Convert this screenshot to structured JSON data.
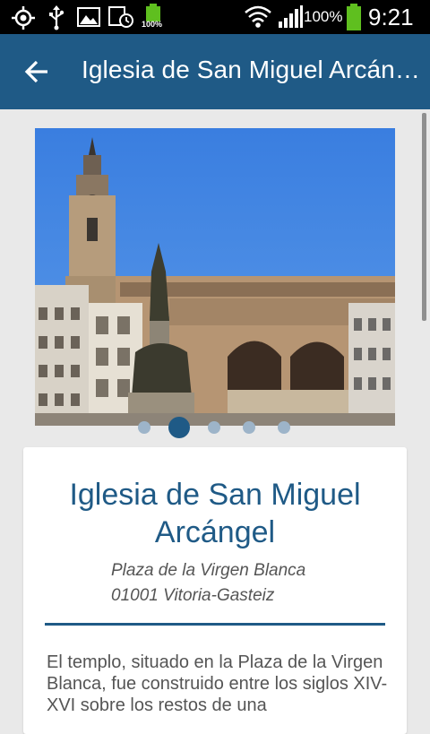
{
  "status_bar": {
    "battery_percent": "100%",
    "time": "9:21",
    "mini_battery_label": "100%",
    "icons": [
      "gps-icon",
      "usb-icon",
      "gallery-icon",
      "screenshot-icon",
      "battery-status-icon",
      "wifi-icon",
      "signal-icon",
      "battery-icon"
    ]
  },
  "app_bar": {
    "back_icon": "arrow-back-icon",
    "title": "Iglesia de San Miguel Arcángel"
  },
  "carousel": {
    "image_description_icon": "church-photo",
    "dot_count": 5,
    "active_index": 1
  },
  "card": {
    "title": "Iglesia de San Miguel Arcángel",
    "address_line1": "Plaza de la Virgen Blanca",
    "address_line2": "01001 Vitoria-Gasteiz",
    "description": "El templo, situado en la Plaza de la Virgen Blanca, fue construido entre los siglos XIV-XVI sobre los restos de una"
  },
  "colors": {
    "primary": "#1f5a86",
    "background": "#e9e9e9",
    "status_bar": "#000000",
    "battery_green": "#5fbf1f"
  }
}
